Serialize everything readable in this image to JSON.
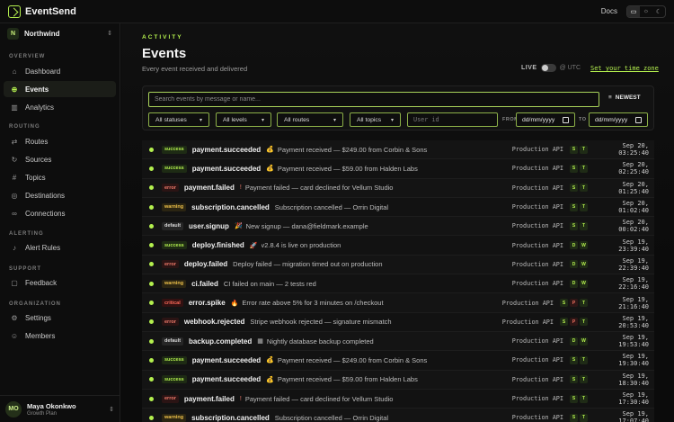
{
  "app": {
    "name": "EventSend",
    "docs_label": "Docs"
  },
  "theme_icons": [
    "monitor-icon",
    "sun-icon",
    "moon-icon"
  ],
  "org": {
    "initial": "N",
    "name": "Northwind"
  },
  "nav": {
    "overview": "OVERVIEW",
    "routing": "ROUTING",
    "alerting": "ALERTING",
    "support": "SUPPORT",
    "organization": "ORGANIZATION",
    "dashboard": "Dashboard",
    "events": "Events",
    "analytics": "Analytics",
    "routes": "Routes",
    "sources": "Sources",
    "topics": "Topics",
    "destinations": "Destinations",
    "connections": "Connections",
    "alert_rules": "Alert Rules",
    "feedback": "Feedback",
    "settings": "Settings",
    "members": "Members"
  },
  "user": {
    "initials": "MO",
    "name": "Maya Okonkwo",
    "plan": "Growth Plan"
  },
  "page": {
    "eyebrow": "ACTIVITY",
    "title": "Events",
    "subtitle": "Every event received and delivered",
    "live_label": "LIVE",
    "utc_label": "@ UTC",
    "tz_link": "Set your time zone"
  },
  "filters": {
    "search_placeholder": "Search events by message or name...",
    "sort_label": "NEWEST",
    "statuses": "All statuses",
    "levels": "All levels",
    "routes": "All routes",
    "topics": "All topics",
    "user_id_placeholder": "User id",
    "from_label": "FROM",
    "to_label": "TO",
    "from_value": "dd/mm/yyyy",
    "to_value": "dd/mm/yyyy"
  },
  "events": [
    {
      "status": "success",
      "name": "payment.succeeded",
      "icon": "💰",
      "message": "Payment received — $249.00 from Corbin & Sons",
      "source": "Production API",
      "tags": [
        "S",
        "T"
      ],
      "time": "Sep 20, 03:25:40"
    },
    {
      "status": "success",
      "name": "payment.succeeded",
      "icon": "💰",
      "message": "Payment received — $59.00 from Halden Labs",
      "source": "Production API",
      "tags": [
        "S",
        "T"
      ],
      "time": "Sep 20, 02:25:40"
    },
    {
      "status": "error",
      "name": "payment.failed",
      "icon": "!",
      "message": "Payment failed — card declined for Vellum Studio",
      "source": "Production API",
      "tags": [
        "S",
        "T"
      ],
      "time": "Sep 20, 01:25:40"
    },
    {
      "status": "warning",
      "name": "subscription.cancelled",
      "icon": "",
      "message": "Subscription cancelled — Orrin Digital",
      "source": "Production API",
      "tags": [
        "S",
        "T"
      ],
      "time": "Sep 20, 01:02:40"
    },
    {
      "status": "default",
      "name": "user.signup",
      "icon": "🎉",
      "message": "New signup — dana@fieldmark.example",
      "source": "Production API",
      "tags": [
        "S",
        "T"
      ],
      "time": "Sep 20, 00:02:40"
    },
    {
      "status": "success",
      "name": "deploy.finished",
      "icon": "🚀",
      "message": "v2.8.4 is live on production",
      "source": "Production API",
      "tags": [
        "D",
        "W"
      ],
      "time": "Sep 19, 23:39:40"
    },
    {
      "status": "error",
      "name": "deploy.failed",
      "icon": "",
      "message": "Deploy failed — migration timed out on production",
      "source": "Production API",
      "tags": [
        "D",
        "W"
      ],
      "time": "Sep 19, 22:39:40"
    },
    {
      "status": "warning",
      "name": "ci.failed",
      "icon": "",
      "message": "CI failed on main — 2 tests red",
      "source": "Production API",
      "tags": [
        "D",
        "W"
      ],
      "time": "Sep 19, 22:16:40"
    },
    {
      "status": "critical",
      "name": "error.spike",
      "icon": "🔥",
      "message": "Error rate above 5% for 3 minutes on /checkout",
      "source": "Production API",
      "tags": [
        "S",
        "P",
        "T"
      ],
      "time": "Sep 19, 21:16:40"
    },
    {
      "status": "error",
      "name": "webhook.rejected",
      "icon": "",
      "message": "Stripe webhook rejected — signature mismatch",
      "source": "Production API",
      "tags": [
        "S",
        "P",
        "T"
      ],
      "time": "Sep 19, 20:53:40"
    },
    {
      "status": "default",
      "name": "backup.completed",
      "icon": "▦",
      "message": "Nightly database backup completed",
      "source": "Production API",
      "tags": [
        "D",
        "W"
      ],
      "time": "Sep 19, 19:53:40"
    },
    {
      "status": "success",
      "name": "payment.succeeded",
      "icon": "💰",
      "message": "Payment received — $249.00 from Corbin & Sons",
      "source": "Production API",
      "tags": [
        "S",
        "T"
      ],
      "time": "Sep 19, 19:30:40"
    },
    {
      "status": "success",
      "name": "payment.succeeded",
      "icon": "💰",
      "message": "Payment received — $59.00 from Halden Labs",
      "source": "Production API",
      "tags": [
        "S",
        "T"
      ],
      "time": "Sep 19, 18:30:40"
    },
    {
      "status": "error",
      "name": "payment.failed",
      "icon": "!",
      "message": "Payment failed — card declined for Vellum Studio",
      "source": "Production API",
      "tags": [
        "S",
        "T"
      ],
      "time": "Sep 19, 17:30:40"
    },
    {
      "status": "warning",
      "name": "subscription.cancelled",
      "icon": "",
      "message": "Subscription cancelled — Orrin Digital",
      "source": "Production API",
      "tags": [
        "S",
        "T"
      ],
      "time": "Sep 19, 17:07:40"
    }
  ]
}
